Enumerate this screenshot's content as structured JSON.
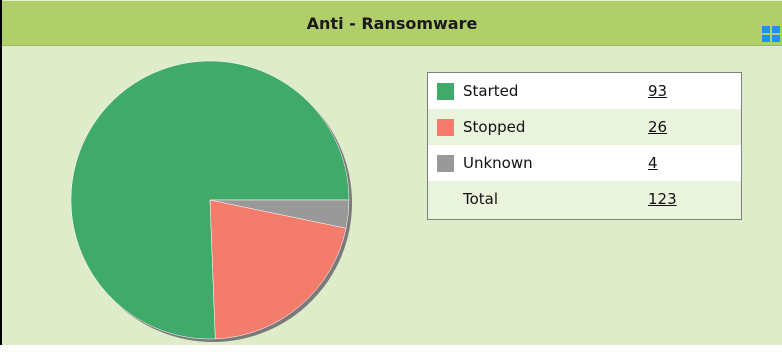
{
  "widget": {
    "title": "Anti - Ransomware"
  },
  "legend": {
    "rows": [
      {
        "label": "Started",
        "value": "93",
        "color": "#3faa6a"
      },
      {
        "label": "Stopped",
        "value": "26",
        "color": "#f47c6d"
      },
      {
        "label": "Unknown",
        "value": "4",
        "color": "#999999"
      }
    ],
    "total": {
      "label": "Total",
      "value": "123"
    }
  },
  "chart_data": {
    "type": "pie",
    "categories": [
      "Started",
      "Stopped",
      "Unknown"
    ],
    "values": [
      93,
      26,
      4
    ],
    "colors": [
      "#3faa6a",
      "#f47c6d",
      "#999999"
    ]
  }
}
